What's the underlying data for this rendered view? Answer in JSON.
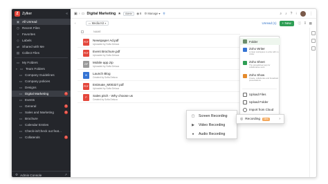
{
  "sidebar": {
    "org": "Zylker",
    "logo": "Z",
    "items": [
      {
        "label": "All Unread",
        "icon": "inbox-icon",
        "glyph": "▣"
      },
      {
        "label": "Recent Files",
        "icon": "clock-icon",
        "glyph": "◷"
      },
      {
        "label": "Favorites",
        "icon": "star-icon",
        "glyph": "☆"
      },
      {
        "label": "Labels",
        "icon": "tag-icon",
        "glyph": "◇"
      },
      {
        "label": "Shared with Me",
        "icon": "share-icon",
        "glyph": "⇄"
      },
      {
        "label": "Collect Files",
        "icon": "collect-icon",
        "glyph": "▤"
      }
    ],
    "folders": [
      {
        "label": "My Folders",
        "glyph": "▭"
      },
      {
        "label": "Team Folders",
        "glyph": "▭"
      },
      {
        "label": "Company Guidelines",
        "glyph": "▭"
      },
      {
        "label": "Company policies",
        "glyph": "▭"
      },
      {
        "label": "Designs",
        "glyph": "▭"
      },
      {
        "label": "Digital Marketing",
        "glyph": "▭",
        "badge": "1"
      },
      {
        "label": "Events",
        "glyph": "▭"
      },
      {
        "label": "General",
        "glyph": "▭",
        "badge": "1"
      },
      {
        "label": "Sales and Marketing",
        "glyph": "▭",
        "badge": "1"
      },
      {
        "label": "Brochure",
        "glyph": "▭"
      },
      {
        "label": "Calendar Entries",
        "glyph": "▭"
      },
      {
        "label": "Check-in/Check out feat...",
        "glyph": "▭"
      },
      {
        "label": "Collaterals",
        "glyph": "▭",
        "badge": "1"
      }
    ],
    "footer": "Admin Console"
  },
  "topbar": {
    "title": "Digital Marketing",
    "role": "Admin",
    "members": "8",
    "manage": "Manage"
  },
  "subbar": {
    "media": "Media Kit",
    "unread": "Unread (1)",
    "new_label": "+ New"
  },
  "list": {
    "col_name": "NAME",
    "files": [
      {
        "name": "Newspaper Ad.pdf",
        "sub": "Uploaded by Sofia Deluca",
        "color": "#e4473c",
        "kind": "PDF"
      },
      {
        "name": "Event Brochure.pdf",
        "sub": "Uploaded by Sofia Deluca",
        "color": "#e4473c",
        "kind": "PDF"
      },
      {
        "name": "Mobile app.zip",
        "sub": "Uploaded by Sofia Deluca",
        "color": "#9a9a9a",
        "kind": "ZIP"
      },
      {
        "name": "Launch Blog",
        "sub": "Created by Sofia Deluca",
        "color": "#3574d4",
        "kind": "W"
      },
      {
        "name": "Estimate_M00327.pdf",
        "sub": "Uploaded by Sofia Deluca",
        "color": "#e4473c",
        "kind": "PDF"
      },
      {
        "name": "Sales pitch - Why choose us",
        "sub": "Created by Sofia Deluca",
        "color": "#e4473c",
        "kind": "P"
      }
    ]
  },
  "new_menu": {
    "folder": "Folder",
    "writer": {
      "label": "Zoho Writer",
      "sub": "A clean workspace to write with no clutter"
    },
    "sheet": {
      "label": "Zoho Sheet",
      "sub": "The spreadsheet app for collaborative work"
    },
    "show": {
      "label": "Zoho Show",
      "sub": "Create, collaborate and broadcast presentations"
    },
    "upload_files": "Upload Files",
    "upload_folder": "Upload Folder",
    "import_cloud": "Import from Cloud"
  },
  "recording": {
    "label": "Recording",
    "badge": "New",
    "items": [
      {
        "label": "Screen Recording",
        "icon": "screen-icon",
        "glyph": "▢"
      },
      {
        "label": "Video Recording",
        "icon": "video-camera-icon",
        "glyph": "▶"
      },
      {
        "label": "Audio Recording",
        "icon": "microphone-icon",
        "glyph": "●"
      }
    ]
  }
}
